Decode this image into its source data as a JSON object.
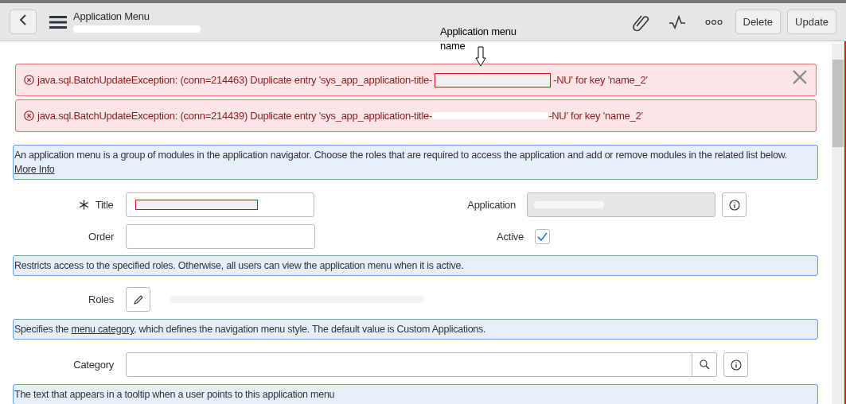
{
  "header": {
    "title": "Application Menu",
    "buttons": [
      "Delete",
      "Update"
    ]
  },
  "annotation": {
    "text": "Application menu name"
  },
  "errors": [
    {
      "prefix": "java.sql.BatchUpdateException: (conn=214463) Duplicate entry 'sys_app_application-title-",
      "suffix": "-NU' for key 'name_2'",
      "highlighted": true,
      "closable": true
    },
    {
      "prefix": "java.sql.BatchUpdateException: (conn=214439) Duplicate entry 'sys_app_application-title-",
      "suffix": "-NU' for key 'name_2'",
      "highlighted": false,
      "closable": false
    }
  ],
  "intro": {
    "text": "An application menu is a group of modules in the application navigator. Choose the roles that are required to access the application and add or remove modules in the related list below.",
    "link": "More Info"
  },
  "fields": {
    "title": {
      "label": "Title",
      "required": true
    },
    "order": {
      "label": "Order",
      "required": false
    },
    "application": {
      "label": "Application"
    },
    "active": {
      "label": "Active",
      "checked": true
    }
  },
  "roles_hint": "Restricts access to the specified roles. Otherwise, all users can view the application menu when it is active.",
  "roles": {
    "label": "Roles"
  },
  "category_hint": {
    "before": "Specifies the ",
    "link": "menu category",
    "after": ", which defines the navigation menu style. The default value is Custom Applications."
  },
  "category": {
    "label": "Category"
  },
  "tooltip_hint": "The text that appears in a tooltip when a user points to this application menu"
}
